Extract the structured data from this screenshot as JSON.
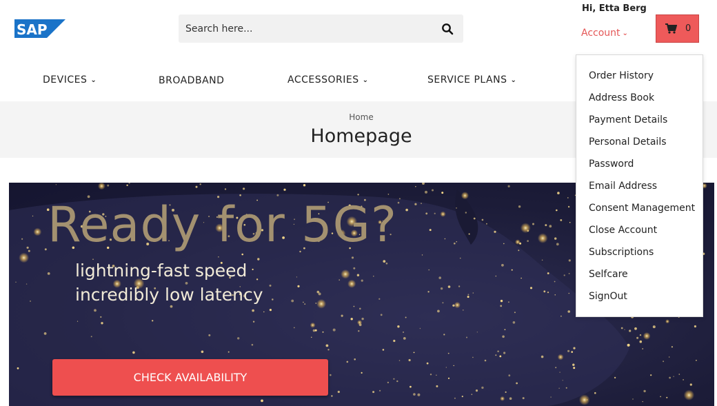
{
  "brand": {
    "logo_text": "SAP",
    "color": "#1a73c8"
  },
  "search": {
    "placeholder": "Search here...",
    "icon": "search-icon"
  },
  "user": {
    "greeting": "Hi, Etta Berg",
    "account_label": "Account"
  },
  "cart": {
    "count": "0",
    "icon": "shopping-cart-icon",
    "color": "#ee5a5a"
  },
  "nav": {
    "items": [
      {
        "label": "DEVICES",
        "has_dropdown": true
      },
      {
        "label": "BROADBAND",
        "has_dropdown": false
      },
      {
        "label": "ACCESSORIES",
        "has_dropdown": true
      },
      {
        "label": "SERVICE PLANS",
        "has_dropdown": true
      }
    ]
  },
  "page": {
    "breadcrumb": "Home",
    "title": "Homepage"
  },
  "hero": {
    "headline": "Ready for 5G?",
    "line1": "lightning-fast speed",
    "line2": "incredibly low latency",
    "cta_label": "CHECK AVAILABILITY",
    "cta_color": "#ee4f4f"
  },
  "account_menu": {
    "items": [
      "Order History",
      "Address Book",
      "Payment Details",
      "Personal Details",
      "Password",
      "Email Address",
      "Consent Management",
      "Close Account",
      "Subscriptions",
      "Selfcare",
      "SignOut"
    ]
  }
}
